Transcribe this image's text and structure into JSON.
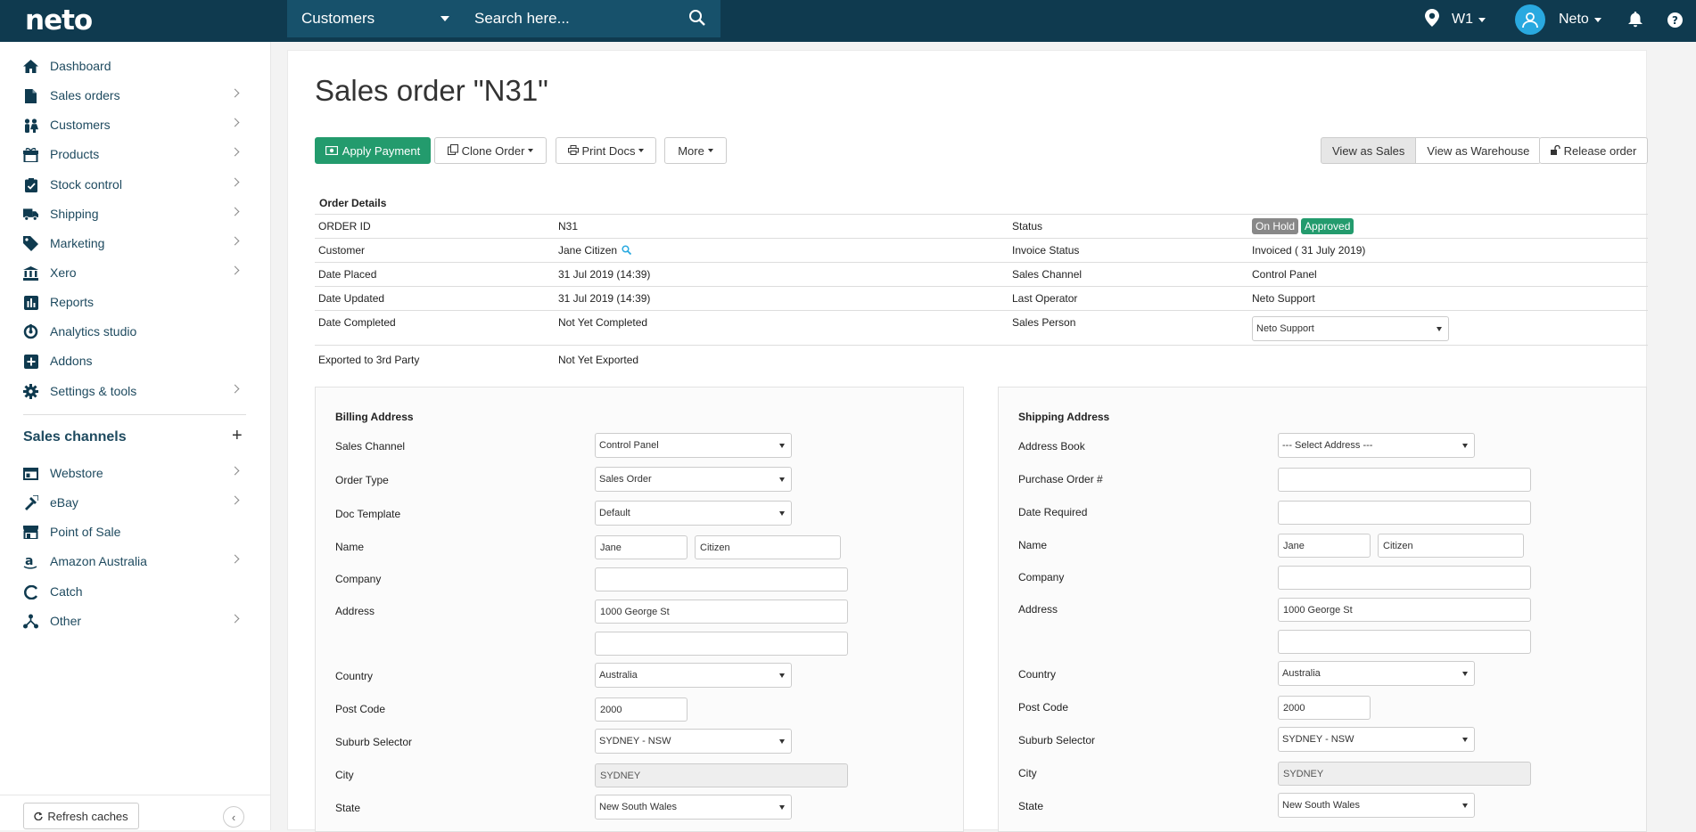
{
  "app": {
    "logo": "neto"
  },
  "topbar": {
    "search_scope": "Customers",
    "search_placeholder": "Search here...",
    "location": "W1",
    "user": "Neto"
  },
  "sidebar": {
    "items": [
      {
        "label": "Dashboard",
        "icon": "home-icon",
        "chevron": false
      },
      {
        "label": "Sales orders",
        "icon": "file-icon",
        "chevron": true
      },
      {
        "label": "Customers",
        "icon": "people-icon",
        "chevron": true
      },
      {
        "label": "Products",
        "icon": "box-icon",
        "chevron": true
      },
      {
        "label": "Stock control",
        "icon": "clipboard-check-icon",
        "chevron": true
      },
      {
        "label": "Shipping",
        "icon": "truck-icon",
        "chevron": true
      },
      {
        "label": "Marketing",
        "icon": "tag-icon",
        "chevron": true
      },
      {
        "label": "Xero",
        "icon": "bank-icon",
        "chevron": true
      },
      {
        "label": "Reports",
        "icon": "bar-chart-icon",
        "chevron": false
      },
      {
        "label": "Analytics studio",
        "icon": "analytics-icon",
        "chevron": false
      },
      {
        "label": "Addons",
        "icon": "plus-square-icon",
        "chevron": false
      },
      {
        "label": "Settings & tools",
        "icon": "gear-icon",
        "chevron": true
      }
    ],
    "sales_channels_title": "Sales channels",
    "channels": [
      {
        "label": "Webstore",
        "icon": "webstore-icon",
        "chevron": true
      },
      {
        "label": "eBay",
        "icon": "ebay-icon",
        "chevron": true
      },
      {
        "label": "Point of Sale",
        "icon": "store-icon",
        "chevron": false
      },
      {
        "label": "Amazon Australia",
        "icon": "amazon-icon",
        "chevron": true
      },
      {
        "label": "Catch",
        "icon": "catch-icon",
        "chevron": false
      },
      {
        "label": "Other",
        "icon": "network-icon",
        "chevron": true
      }
    ],
    "refresh_label": "Refresh caches"
  },
  "page": {
    "title": "Sales order \"N31\"",
    "buttons": {
      "apply_payment": "Apply Payment",
      "clone_order": "Clone Order",
      "print_docs": "Print Docs",
      "more": "More",
      "view_as_sales": "View as Sales",
      "view_as_warehouse": "View as Warehouse",
      "release_order": "Release order"
    }
  },
  "order_details": {
    "title": "Order Details",
    "order_id_label": "ORDER ID",
    "order_id": "N31",
    "customer_label": "Customer",
    "customer": "Jane Citizen",
    "date_placed_label": "Date Placed",
    "date_placed": "31 Jul 2019 (14:39)",
    "date_updated_label": "Date Updated",
    "date_updated": "31 Jul 2019 (14:39)",
    "date_completed_label": "Date Completed",
    "date_completed": "Not Yet Completed",
    "exported_label": "Exported to 3rd Party",
    "exported": "Not Yet Exported",
    "status_label": "Status",
    "status_onhold": "On Hold",
    "status_approved": "Approved",
    "invoice_status_label": "Invoice Status",
    "invoice_status": "Invoiced ( 31 July 2019)",
    "sales_channel_label": "Sales Channel",
    "sales_channel": "Control Panel",
    "last_operator_label": "Last Operator",
    "last_operator": "Neto Support",
    "sales_person_label": "Sales Person",
    "sales_person": "Neto Support",
    "colors": {
      "onhold": "#888888",
      "approved": "#239b6d"
    }
  },
  "billing": {
    "title": "Billing Address",
    "sales_channel_label": "Sales Channel",
    "sales_channel": "Control Panel",
    "order_type_label": "Order Type",
    "order_type": "Sales Order",
    "doc_template_label": "Doc Template",
    "doc_template": "Default",
    "name_label": "Name",
    "first_name": "Jane",
    "last_name": "Citizen",
    "company_label": "Company",
    "company": "",
    "address_label": "Address",
    "address1": "1000 George St",
    "address2": "",
    "country_label": "Country",
    "country": "Australia",
    "postcode_label": "Post Code",
    "postcode": "2000",
    "suburb_label": "Suburb Selector",
    "suburb": "SYDNEY - NSW",
    "city_label": "City",
    "city": "SYDNEY",
    "state_label": "State",
    "state": "New South Wales"
  },
  "shipping": {
    "title": "Shipping Address",
    "address_book_label": "Address Book",
    "address_book": "--- Select Address ---",
    "po_label": "Purchase Order #",
    "po": "",
    "date_required_label": "Date Required",
    "date_required": "",
    "name_label": "Name",
    "first_name": "Jane",
    "last_name": "Citizen",
    "company_label": "Company",
    "company": "",
    "address_label": "Address",
    "address1": "1000 George St",
    "address2": "",
    "country_label": "Country",
    "country": "Australia",
    "postcode_label": "Post Code",
    "postcode": "2000",
    "suburb_label": "Suburb Selector",
    "suburb": "SYDNEY - NSW",
    "city_label": "City",
    "city": "SYDNEY",
    "state_label": "State",
    "state": "New South Wales"
  }
}
